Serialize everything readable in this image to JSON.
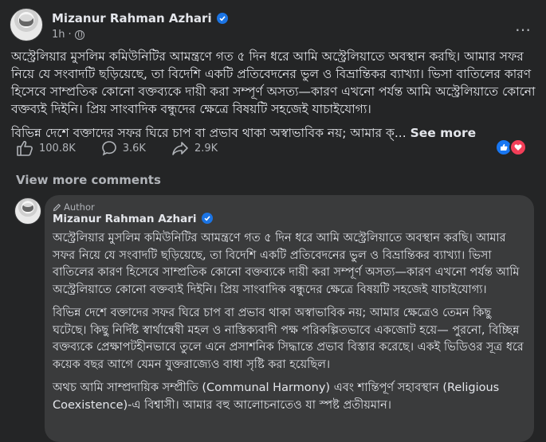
{
  "post": {
    "author": "Mizanur Rahman Azhari",
    "time": "1h",
    "more_icon": "…",
    "paragraph1": "অস্ট্রেলিয়ার মুসলিম কমিউনিটির আমন্ত্রণে গত ৫ দিন ধরে আমি অস্ট্রেলিয়াতে অবস্থান করছি। আমার সফর নিয়ে যে সংবাদটি ছড়িয়েছে, তা বিদেশি একটি প্রতিবেদনের ভুল ও বিভ্রান্তিকর ব্যাখ্যা। ভিসা বাতিলের কারণ হিসেবে সাম্প্রতিক কোনো বক্তব্যকে দায়ী করা সম্পূর্ণ অসত্য—কারণ এখনো পর্যন্ত আমি অস্ট্রেলিয়াতে কোনো বক্তব্যই দিইনি। প্রিয় সাংবাদিক বন্ধুদের ক্ষেত্রে বিষয়টি সহজেই যাচাইযোগ্য।",
    "paragraph2": "বিভিন্ন দেশে বক্তাদের সফর ঘিরে চাপ বা প্রভাব থাকা অস্বাভাবিক নয়; আমার ক্...",
    "see_more": "See more"
  },
  "reactions": {
    "likes": "100.8K",
    "comments": "3.6K",
    "shares": "2.9K"
  },
  "view_more_comments": "View more comments",
  "comment": {
    "author_tag": "Author",
    "author": "Mizanur Rahman Azhari",
    "paragraph1": "অস্ট্রেলিয়ার মুসলিম কমিউনিটির আমন্ত্রণে গত ৫ দিন ধরে আমি অস্ট্রেলিয়াতে অবস্থান করছি। আমার সফর নিয়ে যে সংবাদটি ছড়িয়েছে, তা বিদেশি একটি প্রতিবেদনের ভুল ও বিভ্রান্তিকর ব্যাখ্যা। ভিসা বাতিলের কারণ হিসেবে সাম্প্রতিক কোনো বক্তব্যকে দায়ী করা সম্পূর্ণ অসত্য—কারণ এখনো পর্যন্ত আমি অস্ট্রেলিয়াতে কোনো বক্তব্যই দিইনি। প্রিয় সাংবাদিক বন্ধুদের ক্ষেত্রে বিষয়টি সহজেই যাচাইযোগ্য।",
    "paragraph2": "বিভিন্ন দেশে বক্তাদের সফর ঘিরে চাপ বা প্রভাব থাকা অস্বাভাবিক নয়; আমার ক্ষেত্রেও তেমন কিছু ঘটেছে। কিছু নির্দিষ্ট স্বার্থান্বেষী মহল ও নাস্তিক্যবাদী পক্ষ পরিকল্পিতভাবে একজোট হয়ে— পুরনো, বিচ্ছিন্ন বক্তব্যকে প্রেক্ষাপটহীনভাবে তুলে এনে প্রসাশনিক সিদ্ধান্তে প্রভাব বিস্তার করেছে। একই ভিডিওর সূত্র ধরে কয়েক বছর আগে যেমন যুক্তরাজ্যেও বাধা সৃষ্টি করা হয়েছিল।",
    "paragraph3": "অথচ আমি সাম্প্রদায়িক সম্প্রীতি (Communal Harmony) এবং শান্তিপূর্ণ সহাবস্থান (Religious Coexistence)-এ বিশ্বাসী। আমার বহু আলোচনাতেও যা স্পষ্ট প্রতীয়মান।"
  },
  "colors": {
    "background": "#242526",
    "comment_bubble": "#3a3b3c",
    "verified": "#1b74e4",
    "like": "#1877f2",
    "love": "#f33e58"
  }
}
